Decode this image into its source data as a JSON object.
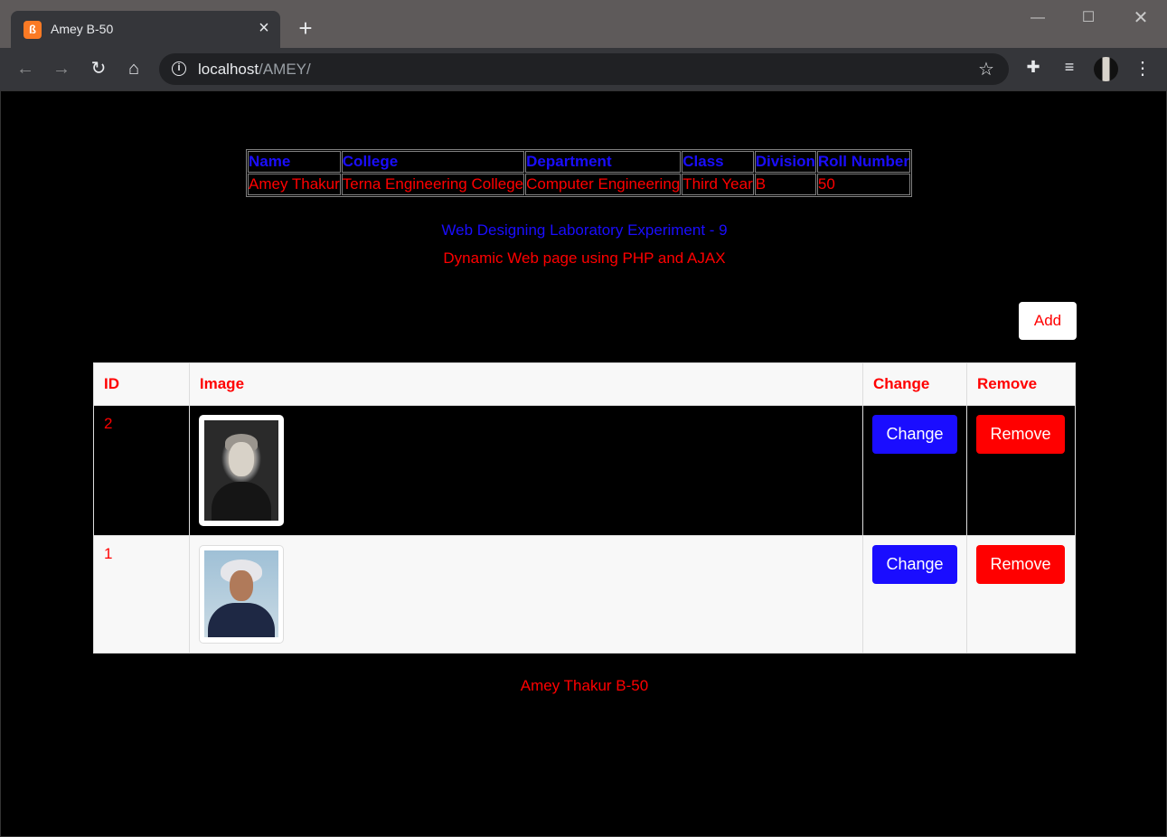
{
  "browser": {
    "tab_title": "Amey B-50",
    "url_host": "localhost",
    "url_path": "/AMEY/"
  },
  "info_table": {
    "headers": [
      "Name",
      "College",
      "Department",
      "Class",
      "Division",
      "Roll Number"
    ],
    "row": [
      "Amey Thakur",
      "Terna Engineering College",
      "Computer Engineering",
      "Third Year",
      "B",
      "50"
    ]
  },
  "subtitle1": "Web Designing Laboratory Experiment - 9",
  "subtitle2": "Dynamic Web page using PHP and AJAX",
  "add_label": "Add",
  "data_table": {
    "headers": [
      "ID",
      "Image",
      "Change",
      "Remove"
    ],
    "rows": [
      {
        "id": "2",
        "change": "Change",
        "remove": "Remove"
      },
      {
        "id": "1",
        "change": "Change",
        "remove": "Remove"
      }
    ]
  },
  "footer": "Amey Thakur B-50",
  "colors": {
    "blue": "#1a0dff",
    "red": "#ff0000",
    "background": "#000000"
  }
}
